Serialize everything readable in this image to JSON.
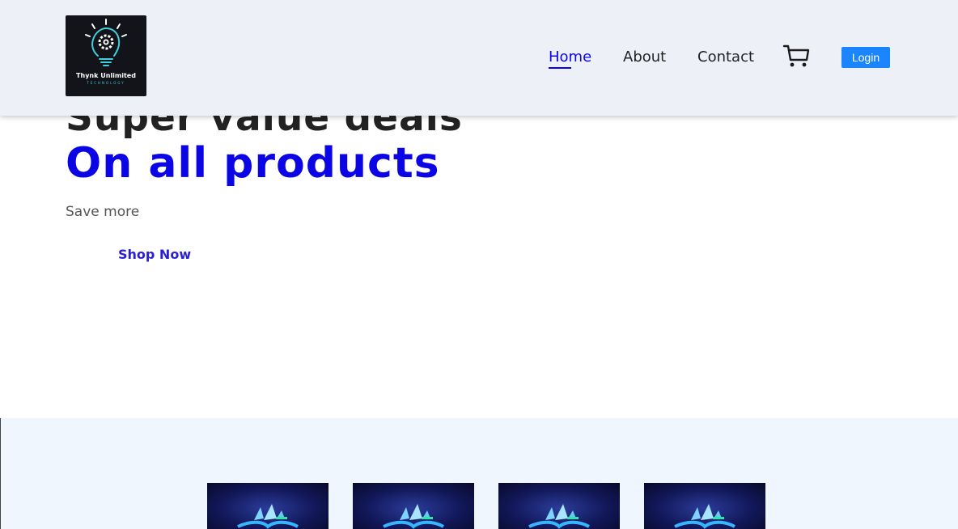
{
  "header": {
    "logo": {
      "name": "Thynk Unlimited",
      "subtitle": "TECHNOLOGY",
      "icon": "lightbulb-gear-icon"
    },
    "nav": [
      {
        "label": "Home",
        "active": true
      },
      {
        "label": "About",
        "active": false
      },
      {
        "label": "Contact",
        "active": false
      }
    ],
    "cart_icon": "shopping-cart-icon",
    "login_label": "Login"
  },
  "hero": {
    "title": "Super value deals",
    "subtitle": "On all products",
    "tagline": "Save more",
    "cta_label": "Shop Now"
  },
  "products": {
    "items": [
      {
        "image": "ship-on-waves-icon"
      },
      {
        "image": "ship-on-waves-icon"
      },
      {
        "image": "ship-on-waves-icon"
      },
      {
        "image": "ship-on-waves-icon"
      }
    ]
  },
  "colors": {
    "accent": "#0b05e6",
    "login_button": "#1b85ff",
    "header_bg": "#eef0f8",
    "products_bg": "#f0f6fd"
  }
}
